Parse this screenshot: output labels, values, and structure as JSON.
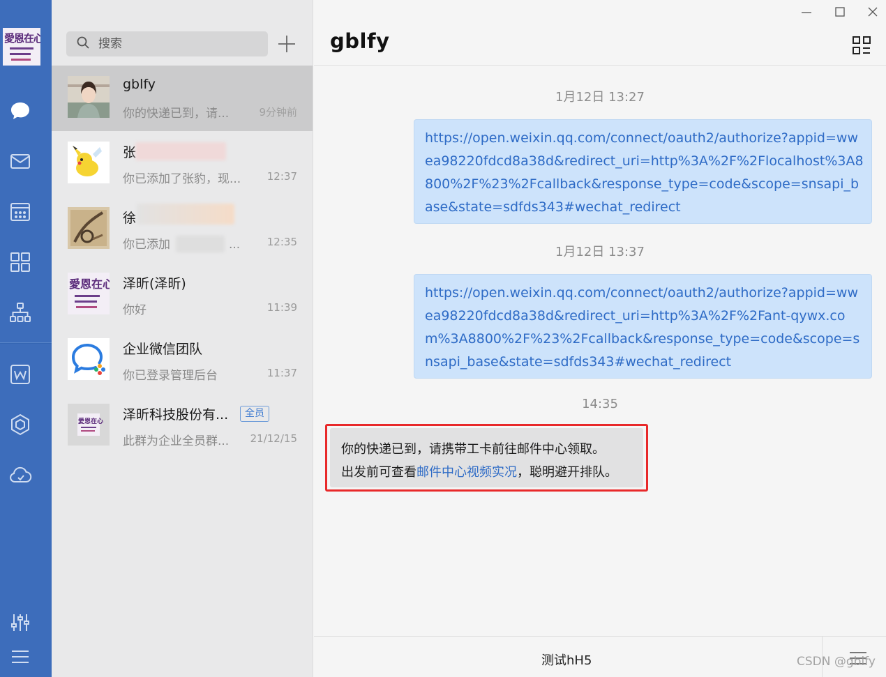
{
  "rail": {
    "icons": [
      "chat-icon",
      "mail-icon",
      "calendar-icon",
      "workbench-icon",
      "org-chart-icon",
      "document-icon",
      "cube-icon",
      "cloud-icon",
      "settings-sliders-icon",
      "menu-icon"
    ]
  },
  "search": {
    "placeholder": "搜索"
  },
  "conversations": [
    {
      "name": "gblfy",
      "preview": "你的快递已到，请...",
      "time": "9分钟前",
      "active": true
    },
    {
      "name": "张",
      "preview": "你已添加了张豹，现...",
      "time": "12:37"
    },
    {
      "name": "徐",
      "preview": "你已添加",
      "preview_suffix": "...",
      "time": "12:35"
    },
    {
      "name": "泽昕(泽昕)",
      "preview": "你好",
      "time": "11:39"
    },
    {
      "name": "企业微信团队",
      "preview": "你已登录管理后台",
      "time": "11:37"
    },
    {
      "name": "泽昕科技股份有...",
      "badge": "全员",
      "preview": "此群为企业全员群...",
      "time": "21/12/15"
    }
  ],
  "chat": {
    "title": "gblfy",
    "messages": [
      {
        "timestamp": "1月12日 13:27",
        "text": "https://open.weixin.qq.com/connect/oauth2/authorize?appid=wwea98220fdcd8a38d&redirect_uri=http%3A%2F%2Flocalhost%3A8800%2F%23%2Fcallback&response_type=code&scope=snsapi_base&state=sdfds343#wechat_redirect"
      },
      {
        "timestamp": "1月12日 13:37",
        "text": "https://open.weixin.qq.com/connect/oauth2/authorize?appid=wwea98220fdcd8a38d&redirect_uri=http%3A%2F%2Fant-qywx.com%3A8800%2F%23%2Fcallback&response_type=code&scope=snsapi_base&state=sdfds343#wechat_redirect"
      },
      {
        "timestamp": "14:35",
        "line1": "你的快递已到，请携带工卡前往邮件中心领取。",
        "line2_prefix": "出发前可查看",
        "line2_link": "邮件中心视频实况",
        "line2_suffix": "，聪明避开排队。"
      }
    ],
    "composer_button": "测试hH5"
  },
  "watermark": "CSDN @gblfy",
  "colors": {
    "rail": "#3d6dbb",
    "bubble_out": "#cde3fb",
    "link": "#2e6bc6",
    "highlight": "#e8292a"
  }
}
